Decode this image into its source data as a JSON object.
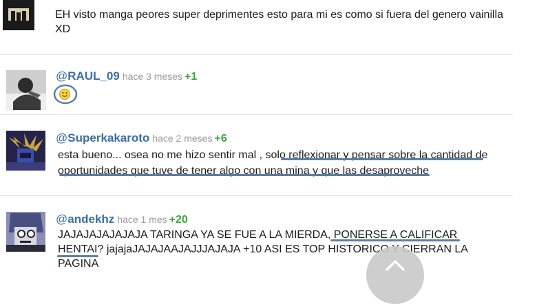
{
  "comments": [
    {
      "username": "",
      "time": "",
      "score": "",
      "text": "EH visto manga peores super deprimentes esto para mi es como si fuera del genero vainilla XD"
    },
    {
      "username": "RAUL_09",
      "time": "hace 3 meses",
      "score": "+1",
      "text": ""
    },
    {
      "username": "Superkakaroto",
      "time": "hace 2 meses",
      "score": "+6",
      "text": "esta bueno... osea no me hizo sentir mal , solo reflexionar y pensar sobre la cantidad de oportunidades que tuve de tener algo con una mina y que las desaproveche"
    },
    {
      "username": "andekhz",
      "time": "hace 1 mes",
      "score": "+20",
      "text": "JAJAJAJAJAJAJA TARINGA YA SE FUE A LA MIERDA, PONERSE A CALIFICAR HENTAI? jajajaJAJAJAAJAJJJAJAJA +10 ASI ES TOP HISTORICO Y CIERRAN LA PAGINA"
    }
  ],
  "at_symbol": "@",
  "icons": {
    "smiley": "smiley-emoticon-icon",
    "scroll_top": "chevron-up-icon"
  },
  "colors": {
    "username": "#3a6ea5",
    "score": "#3aa53a",
    "time": "#9a9a9a",
    "underline": "#5b7ea6"
  }
}
